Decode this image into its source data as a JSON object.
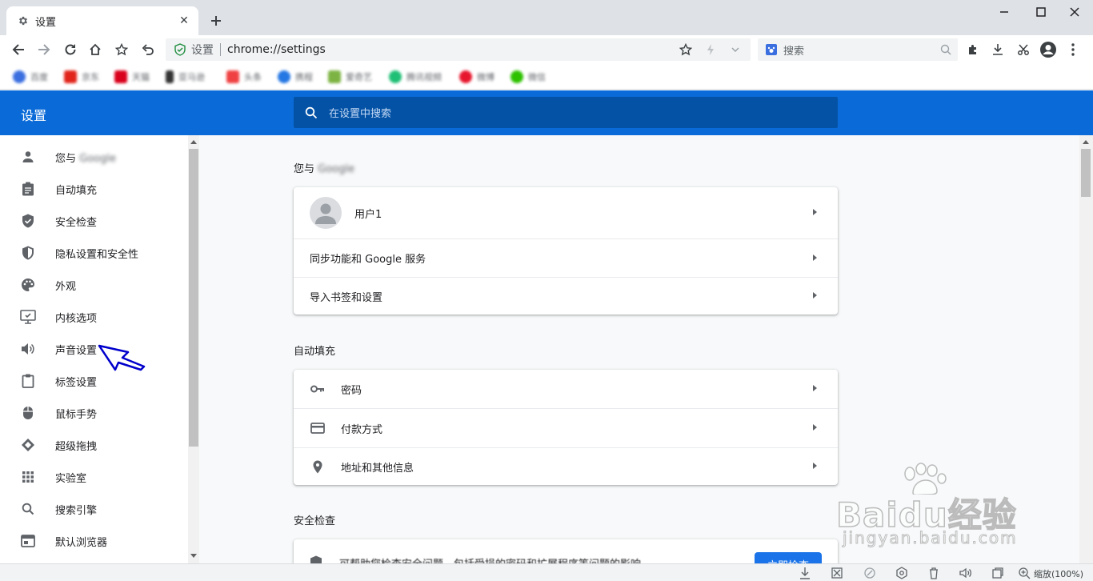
{
  "tab": {
    "title": "设置",
    "close": "✕"
  },
  "window": {
    "minimize": "—",
    "maximize": "☐",
    "close": "✕"
  },
  "omnibox": {
    "label": "设置",
    "url": "chrome://settings"
  },
  "search_box": {
    "placeholder": "搜索"
  },
  "bookmarks": [
    {
      "label": "百度",
      "color": "#3b6fe0"
    },
    {
      "label": "京东",
      "color": "#e1251b"
    },
    {
      "label": "天猫",
      "color": "#d9001b"
    },
    {
      "label": "亚马逊",
      "color": "#333333"
    },
    {
      "label": "头条",
      "color": "#f04142"
    },
    {
      "label": "携程",
      "color": "#2577e3"
    },
    {
      "label": "爱奇艺",
      "color": "#7cb342"
    },
    {
      "label": "腾讯视频",
      "color": "#1fbf75"
    },
    {
      "label": "微博",
      "color": "#e6162d"
    },
    {
      "label": "微信",
      "color": "#2dc100"
    }
  ],
  "header": {
    "title": "设置",
    "search_placeholder": "在设置中搜索"
  },
  "sidebar": {
    "items": [
      {
        "label": "您与",
        "blurred": "Google",
        "icon": "person-icon"
      },
      {
        "label": "自动填充",
        "icon": "clipboard-icon"
      },
      {
        "label": "安全检查",
        "icon": "shield-check-icon"
      },
      {
        "label": "隐私设置和安全性",
        "icon": "shield-half-icon"
      },
      {
        "label": "外观",
        "icon": "palette-icon"
      },
      {
        "label": "内核选项",
        "icon": "monitor-check-icon"
      },
      {
        "label": "声音设置",
        "icon": "speaker-icon"
      },
      {
        "label": "标签设置",
        "icon": "clipboard-tab-icon"
      },
      {
        "label": "鼠标手势",
        "icon": "mouse-icon"
      },
      {
        "label": "超级拖拽",
        "icon": "diamond-arrows-icon"
      },
      {
        "label": "实验室",
        "icon": "grid-icon"
      },
      {
        "label": "搜索引擎",
        "icon": "search-icon"
      },
      {
        "label": "默认浏览器",
        "icon": "browser-icon"
      }
    ]
  },
  "sections": {
    "you_google": {
      "title": "您与",
      "title_blurred": "Google",
      "rows": {
        "user": "用户1",
        "sync": "同步功能和 Google 服务",
        "import": "导入书签和设置"
      }
    },
    "autofill": {
      "title": "自动填充",
      "rows": {
        "passwords": "密码",
        "payment": "付款方式",
        "addresses": "地址和其他信息"
      }
    },
    "safety": {
      "title": "安全检查",
      "text": "可帮助您检查安全问题，包括受损的密码和扩展程序等问题的影响",
      "button": "立即检查"
    }
  },
  "status_bar": {
    "zoom": "缩放(100%)"
  },
  "watermark": {
    "main": "Baidu经验",
    "sub": "jingyan.baidu.com"
  },
  "colors": {
    "header": "#0a6bd8",
    "header_search": "#0452a6",
    "accent": "#1a73e8",
    "annotation_arrow": "#0000cc"
  }
}
